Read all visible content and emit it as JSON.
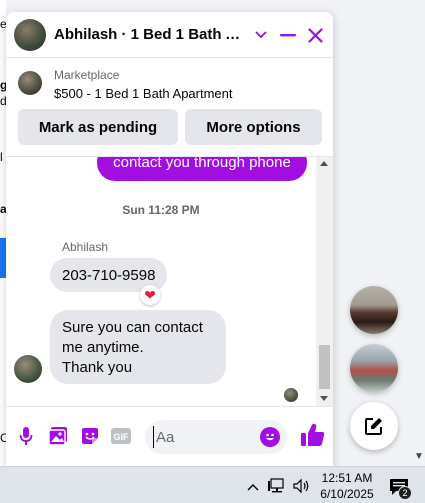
{
  "background": {
    "fragments": [
      "e",
      "g",
      "d",
      "l",
      "a",
      "C"
    ]
  },
  "chat": {
    "contact_title": "Abhilash · 1 Bed 1 Bath Ap...",
    "marketplace": {
      "label": "Marketplace",
      "listing": "$500 - 1 Bed 1 Bath Apartment"
    },
    "actions": {
      "pending_label": "Mark as pending",
      "more_label": "More options"
    },
    "messages": {
      "partial_sent": "contact you through phone",
      "timestamp": "Sun 11:28 PM",
      "sender_name": "Abhilash",
      "phone_message": "203-710-9598",
      "reply_lines": [
        "Sure you can contact",
        "me anytime.",
        "Thank you"
      ]
    },
    "composer": {
      "placeholder": "Aa",
      "gif_label": "GIF"
    },
    "accent_color": "#a20ee0"
  },
  "taskbar": {
    "time": "12:51 AM",
    "date": "6/10/2025",
    "notification_count": "2"
  }
}
